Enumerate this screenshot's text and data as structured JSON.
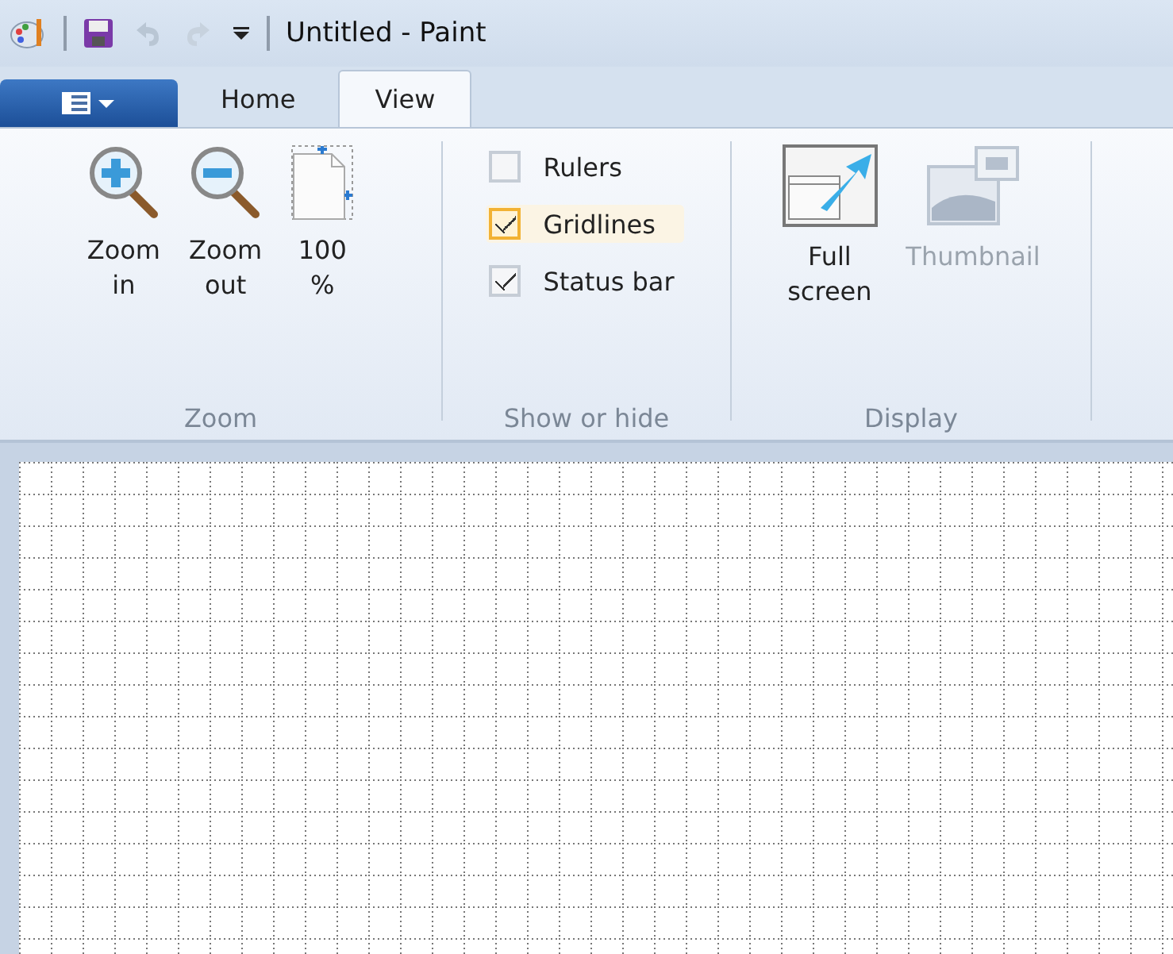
{
  "window": {
    "title": "Untitled - Paint"
  },
  "tabs": [
    {
      "label": "Home",
      "selected": false
    },
    {
      "label": "View",
      "selected": true
    }
  ],
  "ribbon": {
    "groups": [
      {
        "label": "Zoom",
        "kind": "buttons",
        "buttons": [
          {
            "label": "Zoom in",
            "kind": "zoom-in",
            "disabled": false
          },
          {
            "label": "Zoom out",
            "kind": "zoom-out",
            "disabled": false
          },
          {
            "label": "100 %",
            "kind": "page",
            "disabled": false
          }
        ]
      },
      {
        "label": "Show or hide",
        "kind": "checks",
        "checks": [
          {
            "label": "Rulers",
            "checked": false,
            "hovered": false
          },
          {
            "label": "Gridlines",
            "checked": true,
            "hovered": true
          },
          {
            "label": "Status bar",
            "checked": true,
            "hovered": false
          }
        ]
      },
      {
        "label": "Display",
        "kind": "buttons",
        "buttons": [
          {
            "label": "Full screen",
            "kind": "full-screen",
            "disabled": false
          },
          {
            "label": "Thumbnail",
            "kind": "thumbnail",
            "disabled": true
          }
        ]
      }
    ]
  },
  "canvas": {
    "gridlines": true
  }
}
